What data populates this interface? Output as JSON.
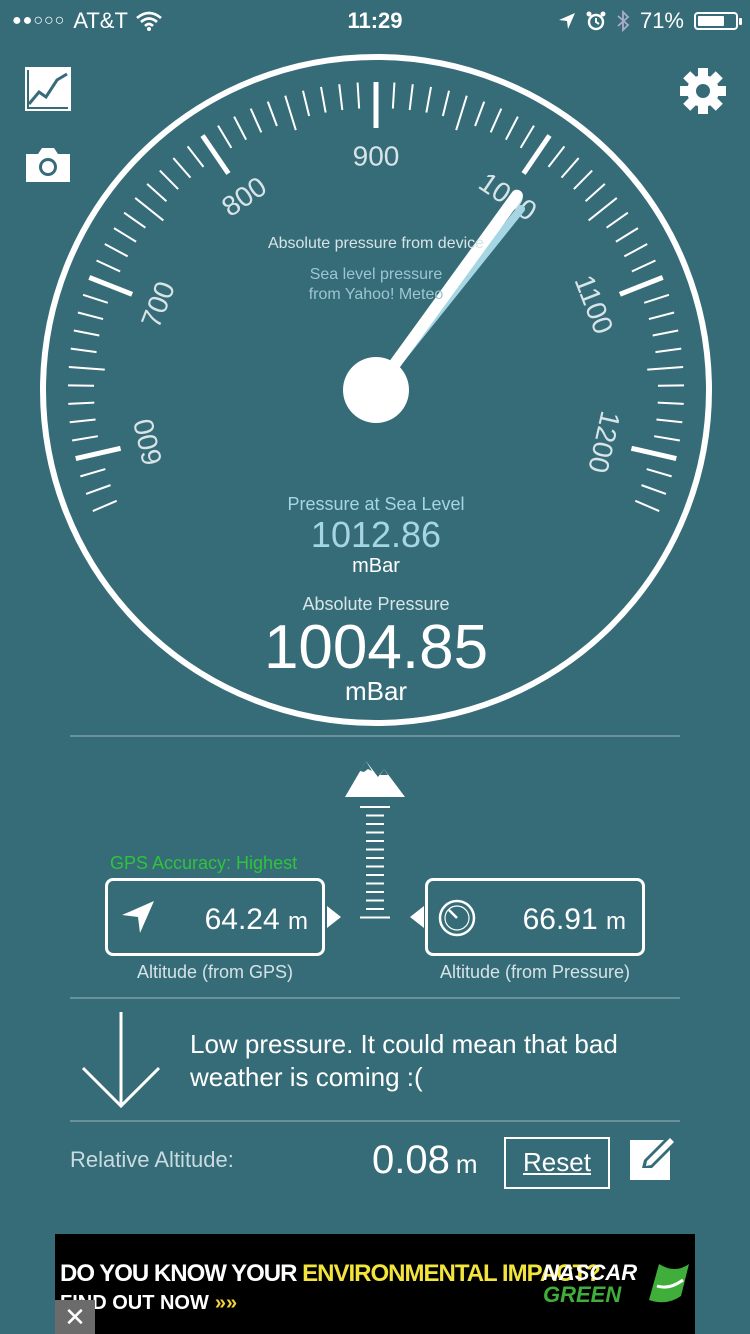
{
  "status_bar": {
    "signal_dots": "●●○○○",
    "carrier": "AT&T",
    "time": "11:29",
    "battery_percent": "71%",
    "battery_level": 0.71
  },
  "toolbar": {
    "chart_icon": "chart-line-icon",
    "camera_icon": "camera-icon",
    "settings_icon": "gear-icon"
  },
  "gauge": {
    "scale_labels": [
      "600",
      "700",
      "800",
      "900",
      "1000",
      "1100",
      "1200"
    ],
    "scale_min": 550,
    "scale_max": 1250,
    "absolute_needle_value": 1004.85,
    "sea_level_needle_value": 1012.86,
    "legend_device": "Absolute pressure from device",
    "legend_sea_level_line1": "Sea level pressure",
    "legend_sea_level_line2": "from Yahoo! Meteo",
    "sea_level_label": "Pressure at Sea Level",
    "sea_level_value": "1012.86",
    "sea_level_unit": "mBar",
    "absolute_label": "Absolute Pressure",
    "absolute_value": "1004.85",
    "absolute_unit": "mBar"
  },
  "altitude": {
    "gps_accuracy": "GPS Accuracy: Highest",
    "gps_value": "64.24",
    "gps_unit": "m",
    "gps_caption": "Altitude (from GPS)",
    "pressure_value": "66.91",
    "pressure_unit": "m",
    "pressure_caption": "Altitude (from Pressure)"
  },
  "forecast": {
    "message": "Low pressure. It could mean that bad weather is coming :(",
    "icon": "arrow-down-icon"
  },
  "relative": {
    "label": "Relative Altitude:",
    "value": "0.08",
    "unit": "m",
    "reset_label": "Reset",
    "edit_icon": "edit-icon"
  },
  "ad": {
    "line1_part1": "DO YOU KNOW YOUR ",
    "line1_part2": "ENVIRONMENTAL IMPACT?",
    "line2": "FIND OUT NOW",
    "line2_arrows": "»»",
    "brand_top": "NASCAR",
    "brand_bottom": "GREEN",
    "close": "✕"
  },
  "colors": {
    "background": "#366c78",
    "needle_sea_level": "#a6d6e3",
    "sea_level_text": "#a6d6e3",
    "gps_accuracy": "#2ec43b"
  }
}
